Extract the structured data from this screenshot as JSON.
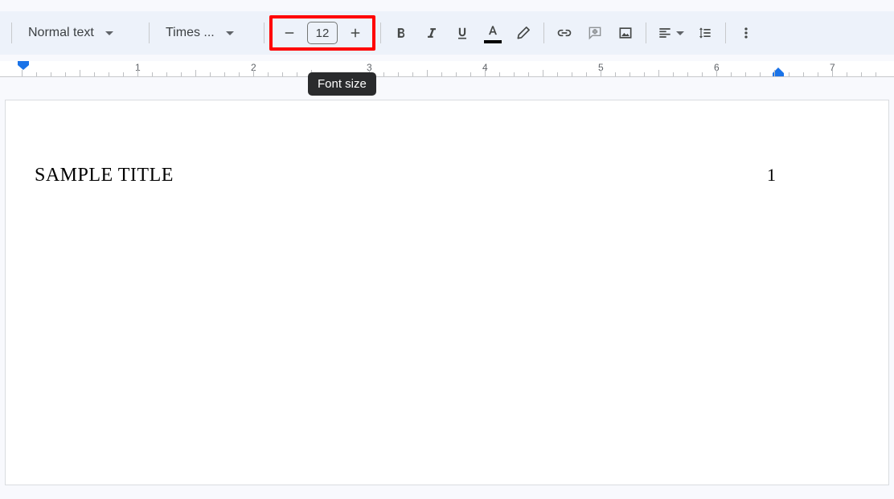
{
  "toolbar": {
    "style_label": "Normal text",
    "font_label": "Times ...",
    "font_size": "12",
    "tooltip": "Font size"
  },
  "ruler": {
    "numbers": [
      "1",
      "2",
      "3",
      "4",
      "5",
      "6",
      "7"
    ]
  },
  "doc": {
    "header_text": "SAMPLE TITLE",
    "page_number": "1"
  }
}
